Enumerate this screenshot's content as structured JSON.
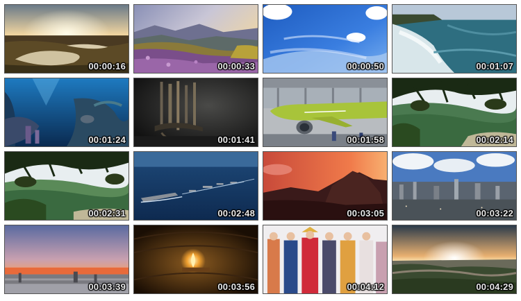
{
  "contact_sheet": {
    "thumbnails": [
      {
        "timestamp": "00:00:16",
        "scene": "sunset-lake-landscape"
      },
      {
        "timestamp": "00:00:33",
        "scene": "mountain-flower-meadow"
      },
      {
        "timestamp": "00:00:50",
        "scene": "blue-sky-clouds"
      },
      {
        "timestamp": "00:01:07",
        "scene": "coastal-cliffs-sea"
      },
      {
        "timestamp": "00:01:24",
        "scene": "underwater-reef"
      },
      {
        "timestamp": "00:01:41",
        "scene": "dark-bronze-instrument"
      },
      {
        "timestamp": "00:01:58",
        "scene": "green-airliner-hangar"
      },
      {
        "timestamp": "00:02:14",
        "scene": "pine-branches-valley"
      },
      {
        "timestamp": "00:02:31",
        "scene": "pine-branches-valley-2"
      },
      {
        "timestamp": "00:02:48",
        "scene": "naval-fleet-ocean"
      },
      {
        "timestamp": "00:03:05",
        "scene": "sunset-mountain-peak"
      },
      {
        "timestamp": "00:03:22",
        "scene": "city-skyline-clouds"
      },
      {
        "timestamp": "00:03:39",
        "scene": "dusk-horizon-terrace"
      },
      {
        "timestamp": "00:03:56",
        "scene": "candle-flame-dark"
      },
      {
        "timestamp": "00:04:12",
        "scene": "costumed-performers-group"
      },
      {
        "timestamp": "00:04:29",
        "scene": "sunrise-great-wall"
      }
    ]
  }
}
